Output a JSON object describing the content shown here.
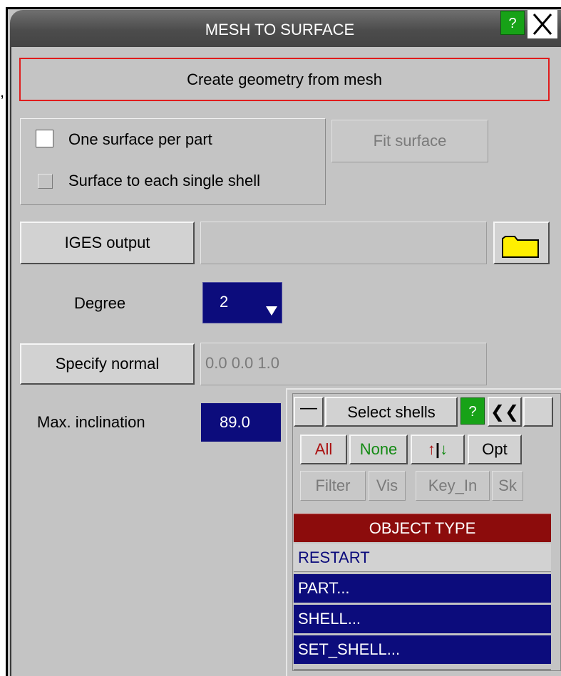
{
  "window": {
    "title": "MESH TO SURFACE",
    "help_label": "?",
    "close_label": "X"
  },
  "stray_mark": ",",
  "create_geometry_label": "Create geometry from mesh",
  "options": {
    "one_surface_per_part": {
      "label": "One surface per part",
      "checked": false
    },
    "surface_each_shell": {
      "label": "Surface to each single shell",
      "checked": false
    }
  },
  "fit_surface_label": "Fit surface",
  "iges": {
    "button_label": "IGES output",
    "filename": "",
    "folder_icon": "folder-icon"
  },
  "degree": {
    "label": "Degree",
    "value": "2"
  },
  "normal": {
    "button_label": "Specify normal",
    "value": "0.0  0.0  1.0"
  },
  "max_inclination": {
    "label": "Max. inclination",
    "value": "89.0"
  },
  "select_panel": {
    "minimize_label": "—",
    "title": "Select shells",
    "help_label": "?",
    "back_label": "❮❮",
    "buttons": {
      "all": "All",
      "none": "None",
      "flip": "↑|↓",
      "opt": "Opt"
    },
    "filters": {
      "filter": "Filter",
      "vis": "Vis",
      "key_in": "Key_In",
      "sk": "Sk"
    },
    "object_type_header": "OBJECT TYPE",
    "object_types": [
      "RESTART",
      "PART...",
      "SHELL...",
      "SET_SHELL..."
    ]
  },
  "colors": {
    "panel_bg": "#c4c4c4",
    "selection_blue": "#0c0c7c",
    "header_red": "#8c0c0c",
    "help_green": "#17a217",
    "outline_red": "#e01c1c",
    "folder_yellow": "#ffef00"
  }
}
